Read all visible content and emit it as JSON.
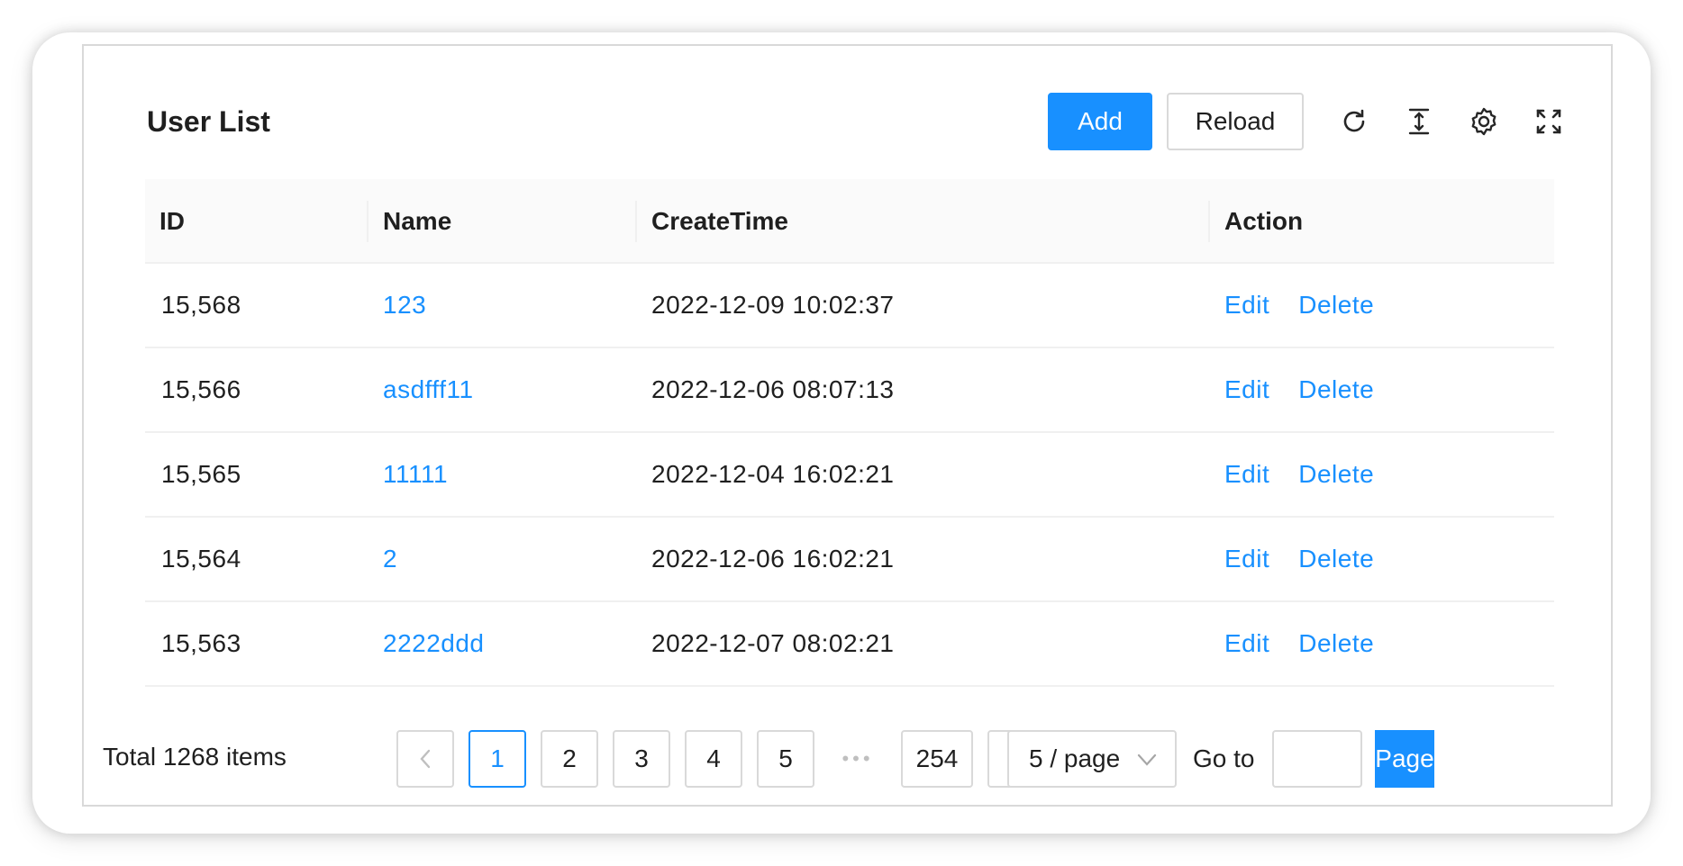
{
  "header": {
    "title": "User List",
    "add_label": "Add",
    "reload_label": "Reload",
    "icons": [
      "reload-icon",
      "column-height-icon",
      "setting-icon",
      "fullscreen-icon"
    ]
  },
  "table": {
    "columns": [
      "ID",
      "Name",
      "CreateTime",
      "Action"
    ],
    "rows": [
      {
        "id": "15,568",
        "name": "123",
        "create_time": "2022-12-09 10:02:37",
        "edit": "Edit",
        "delete": "Delete"
      },
      {
        "id": "15,566",
        "name": "asdfff11",
        "create_time": "2022-12-06 08:07:13",
        "edit": "Edit",
        "delete": "Delete"
      },
      {
        "id": "15,565",
        "name": "11111",
        "create_time": "2022-12-04 16:02:21",
        "edit": "Edit",
        "delete": "Delete"
      },
      {
        "id": "15,564",
        "name": "2",
        "create_time": "2022-12-06 16:02:21",
        "edit": "Edit",
        "delete": "Delete"
      },
      {
        "id": "15,563",
        "name": "2222ddd",
        "create_time": "2022-12-07 08:02:21",
        "edit": "Edit",
        "delete": "Delete"
      }
    ]
  },
  "pagination": {
    "total_text": "Total 1268 items",
    "pages": [
      "1",
      "2",
      "3",
      "4",
      "5"
    ],
    "current_page": "1",
    "ellipsis": "•••",
    "last_page": "254",
    "page_size": "5 / page",
    "goto_label": "Go to",
    "goto_value": "",
    "goto_button": "Page"
  },
  "colors": {
    "primary": "#1890ff",
    "border": "#d9d9d9",
    "header_bg": "#fafafa"
  }
}
